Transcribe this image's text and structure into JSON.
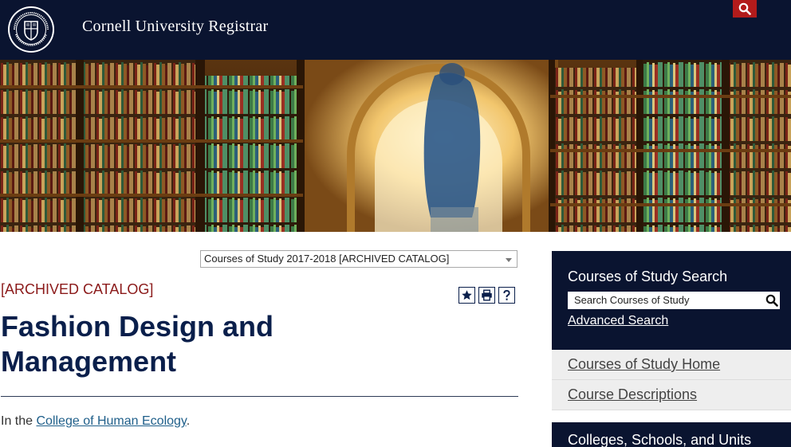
{
  "header": {
    "site_title": "Cornell University Registrar",
    "seal_text": "CORNELL UNIVERSITY FOUNDED A.D. 1865",
    "search_icon": "search-icon",
    "colors": {
      "background": "#0a1430",
      "accent": "#b31b1b"
    }
  },
  "main": {
    "catalog_select": {
      "selected": "Courses of Study 2017-2018 [ARCHIVED CATALOG]"
    },
    "archived_label": "[ARCHIVED CATALOG]",
    "tools": [
      "star-icon",
      "print-icon",
      "help-icon"
    ],
    "title": "Fashion Design and Management",
    "intro": {
      "prefix": "In the ",
      "link": "College of Human Ecology",
      "suffix": "."
    }
  },
  "sidebar": {
    "search_heading": "Courses of Study Search",
    "search_placeholder": "Search Courses of Study",
    "advanced_search": "Advanced Search",
    "nav": [
      {
        "label": "Courses of Study Home"
      },
      {
        "label": "Course Descriptions"
      }
    ],
    "colleges_heading": "Colleges, Schools, and Units"
  }
}
